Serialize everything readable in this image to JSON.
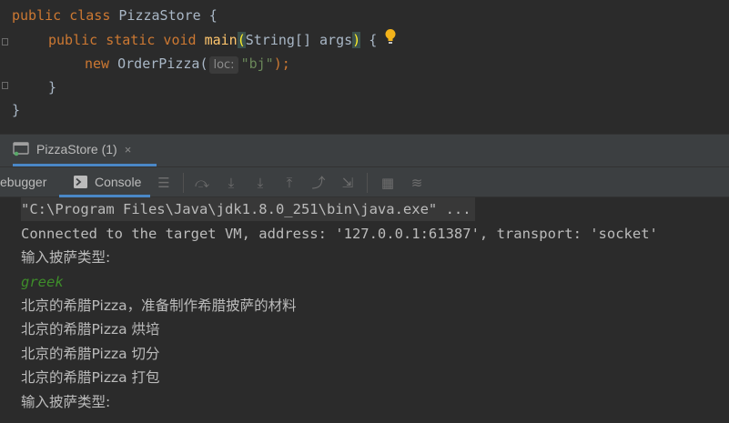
{
  "editor": {
    "line1": {
      "kw": "public class ",
      "name": "PizzaStore",
      "brace": " {"
    },
    "line2": {
      "kw": "public static void ",
      "fn": "main",
      "lparen": "(",
      "params": "String[] args",
      "rparen": ")",
      "brace": " {"
    },
    "line3": {
      "kw": "new ",
      "cls": "OrderPizza",
      "lparen": "(",
      "hint": "loc:",
      "str": "\"bj\"",
      "rest": ");"
    },
    "line4": "}",
    "line5": "}"
  },
  "run_tab": {
    "label": "PizzaStore (1)",
    "close": "×"
  },
  "subbar": {
    "debugger_label": "ebugger",
    "console_label": "Console"
  },
  "console": {
    "cmd": "\"C:\\Program Files\\Java\\jdk1.8.0_251\\bin\\java.exe\" ...",
    "connected": "Connected to the target VM, address: '127.0.0.1:61387', transport: 'socket'",
    "prompt1": "输入披萨类型:",
    "input": "greek",
    "out1": "北京的希腊Pizza，准备制作希腊披萨的材料",
    "out2": "北京的希腊Pizza 烘培",
    "out3": "北京的希腊Pizza 切分",
    "out4": "北京的希腊Pizza 打包",
    "prompt2": "输入披萨类型:"
  },
  "colors": {
    "keyword": "#cc7832",
    "function": "#ffc66d",
    "string": "#6a8759",
    "accent": "#4a88c7",
    "input": "#3e8d2a"
  }
}
